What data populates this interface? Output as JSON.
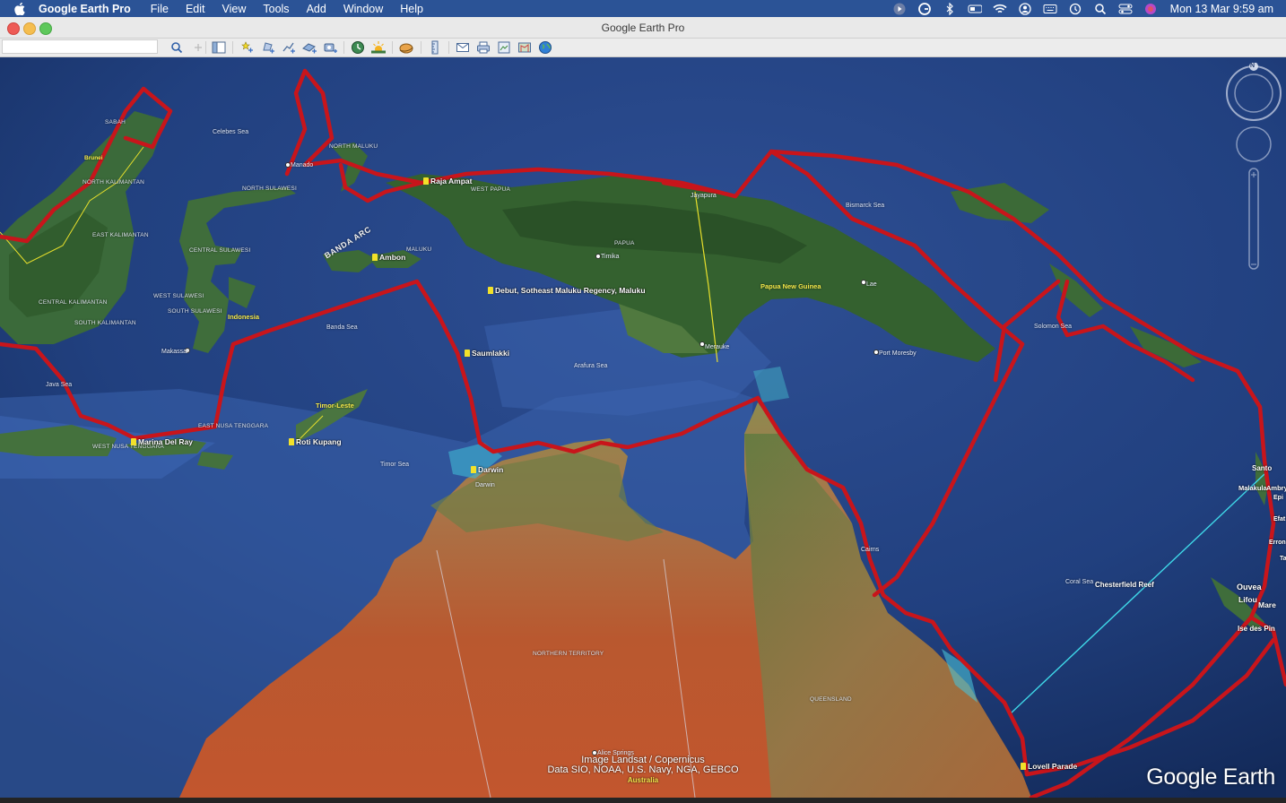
{
  "menubar": {
    "app_name": "Google Earth Pro",
    "items": [
      "File",
      "Edit",
      "View",
      "Tools",
      "Add",
      "Window",
      "Help"
    ],
    "clock": "Mon 13 Mar  9:59 am"
  },
  "window": {
    "title": "Google Earth Pro"
  },
  "toolbar": {
    "search_value": ""
  },
  "map": {
    "seas": [
      {
        "text": "Celebes Sea"
      },
      {
        "text": "Banda Sea"
      },
      {
        "text": "Arafura Sea"
      },
      {
        "text": "Timor Sea"
      },
      {
        "text": "Java Sea"
      },
      {
        "text": "Bismarck Sea"
      },
      {
        "text": "Solomon Sea"
      },
      {
        "text": "Coral Sea"
      }
    ],
    "regions": [
      {
        "text": "SABAH"
      },
      {
        "text": "NORTH KALIMANTAN"
      },
      {
        "text": "EAST KALIMANTAN"
      },
      {
        "text": "CENTRAL KALIMANTAN"
      },
      {
        "text": "SOUTH KALIMANTAN"
      },
      {
        "text": "NORTH MALUKU"
      },
      {
        "text": "NORTH SULAWESI"
      },
      {
        "text": "CENTRAL SULAWESI"
      },
      {
        "text": "WEST SULAWESI"
      },
      {
        "text": "SOUTH SULAWESI"
      },
      {
        "text": "MALUKU"
      },
      {
        "text": "WEST PAPUA"
      },
      {
        "text": "PAPUA"
      },
      {
        "text": "EAST NUSA TENGGARA"
      },
      {
        "text": "WEST NUSA TENGGARA"
      },
      {
        "text": "NORTHERN TERRITORY"
      },
      {
        "text": "QUEENSLAND"
      }
    ],
    "countries": [
      {
        "text": "Indonesia"
      },
      {
        "text": "Timor-Leste"
      },
      {
        "text": "Papua New Guinea"
      },
      {
        "text": "Brunei"
      }
    ],
    "cities": [
      {
        "text": "Manado"
      },
      {
        "text": "Makassar"
      },
      {
        "text": "Timika"
      },
      {
        "text": "Jayapura"
      },
      {
        "text": "Merauke"
      },
      {
        "text": "Lae"
      },
      {
        "text": "Port Moresby"
      },
      {
        "text": "Darwin"
      },
      {
        "text": "Cairns"
      },
      {
        "text": "Alice Springs"
      }
    ],
    "placemarks": [
      {
        "text": "Raja Ampat"
      },
      {
        "text": "Ambon"
      },
      {
        "text": "Debut, Sotheast Maluku Regency, Maluku"
      },
      {
        "text": "Saumlakki"
      },
      {
        "text": "Marina Del Ray"
      },
      {
        "text": "Roti Kupang"
      },
      {
        "text": "Darwin"
      },
      {
        "text": "Lovell Parade"
      }
    ],
    "banda_arc": "BANDA ARC",
    "right_places": [
      {
        "text": "Santo"
      },
      {
        "text": "Malakula"
      },
      {
        "text": "Ambry"
      },
      {
        "text": "Epi"
      },
      {
        "text": "Efat"
      },
      {
        "text": "Erron"
      },
      {
        "text": "Ta"
      },
      {
        "text": "Ouvea"
      },
      {
        "text": "Lifou"
      },
      {
        "text": "Mare"
      },
      {
        "text": "Ise des Pin"
      },
      {
        "text": "Chesterfield Reef"
      }
    ],
    "nav_north": "N",
    "attribution_line1": "Image Landsat / Copernicus",
    "attribution_line2": "Data SIO, NOAA, U.S. Navy, NGA, GEBCO",
    "attribution_country": "Australia",
    "logo": "Google Earth"
  },
  "colors": {
    "menubar": "#2b5396",
    "track": "#c8151b",
    "ocean": "#1f3a78",
    "land": "#2f5a2c",
    "desert": "#b8623a"
  }
}
